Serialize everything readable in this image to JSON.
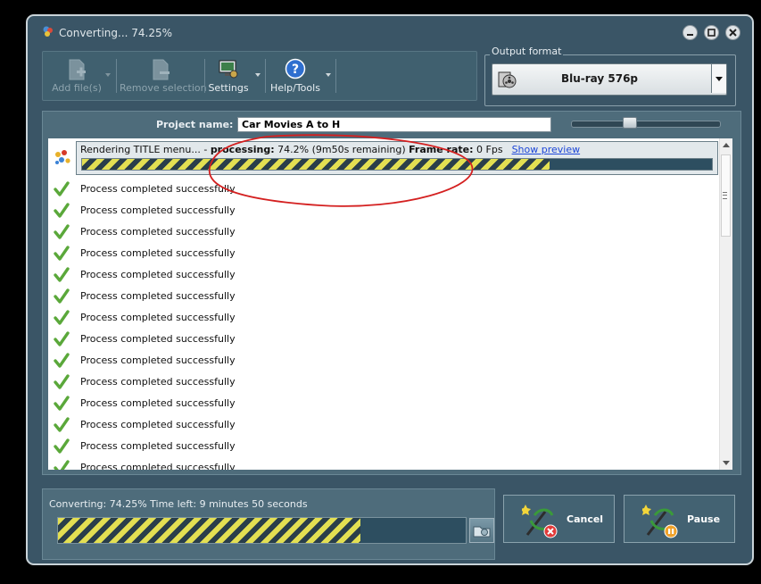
{
  "window": {
    "title": "Converting... 74.25%"
  },
  "toolbar": {
    "add_files": "Add file(s)",
    "remove_selection": "Remove selection",
    "settings": "Settings",
    "help_tools": "Help/Tools"
  },
  "output": {
    "legend": "Output format",
    "format": "Blu-ray 576p"
  },
  "project": {
    "label": "Project name:",
    "name": "Car Movies A to H"
  },
  "rendering": {
    "prefix": "Rendering TITLE menu... - ",
    "status_label": "processing:",
    "status_value": " 74.2% (9m50s remaining) ",
    "framerate_label": "Frame rate:",
    "framerate_value": " 0 Fps",
    "preview_link": "Show preview",
    "progress": 0.742
  },
  "tasks": [
    "Process completed successfully",
    "Process completed successfully",
    "Process completed successfully",
    "Process completed successfully",
    "Process completed successfully",
    "Process completed successfully",
    "Process completed successfully",
    "Process completed successfully",
    "Process completed successfully",
    "Process completed successfully",
    "Process completed successfully",
    "Process completed successfully",
    "Process completed successfully",
    "Process completed successfully"
  ],
  "status": {
    "text": "Converting: 74.25% Time left: 9 minutes 50 seconds",
    "progress": 0.7425
  },
  "actions": {
    "cancel": "Cancel",
    "pause": "Pause"
  },
  "colors": {
    "window_bg": "#3a5566",
    "stripe_yellow": "#e3df52",
    "annotation_red": "#d42020"
  }
}
